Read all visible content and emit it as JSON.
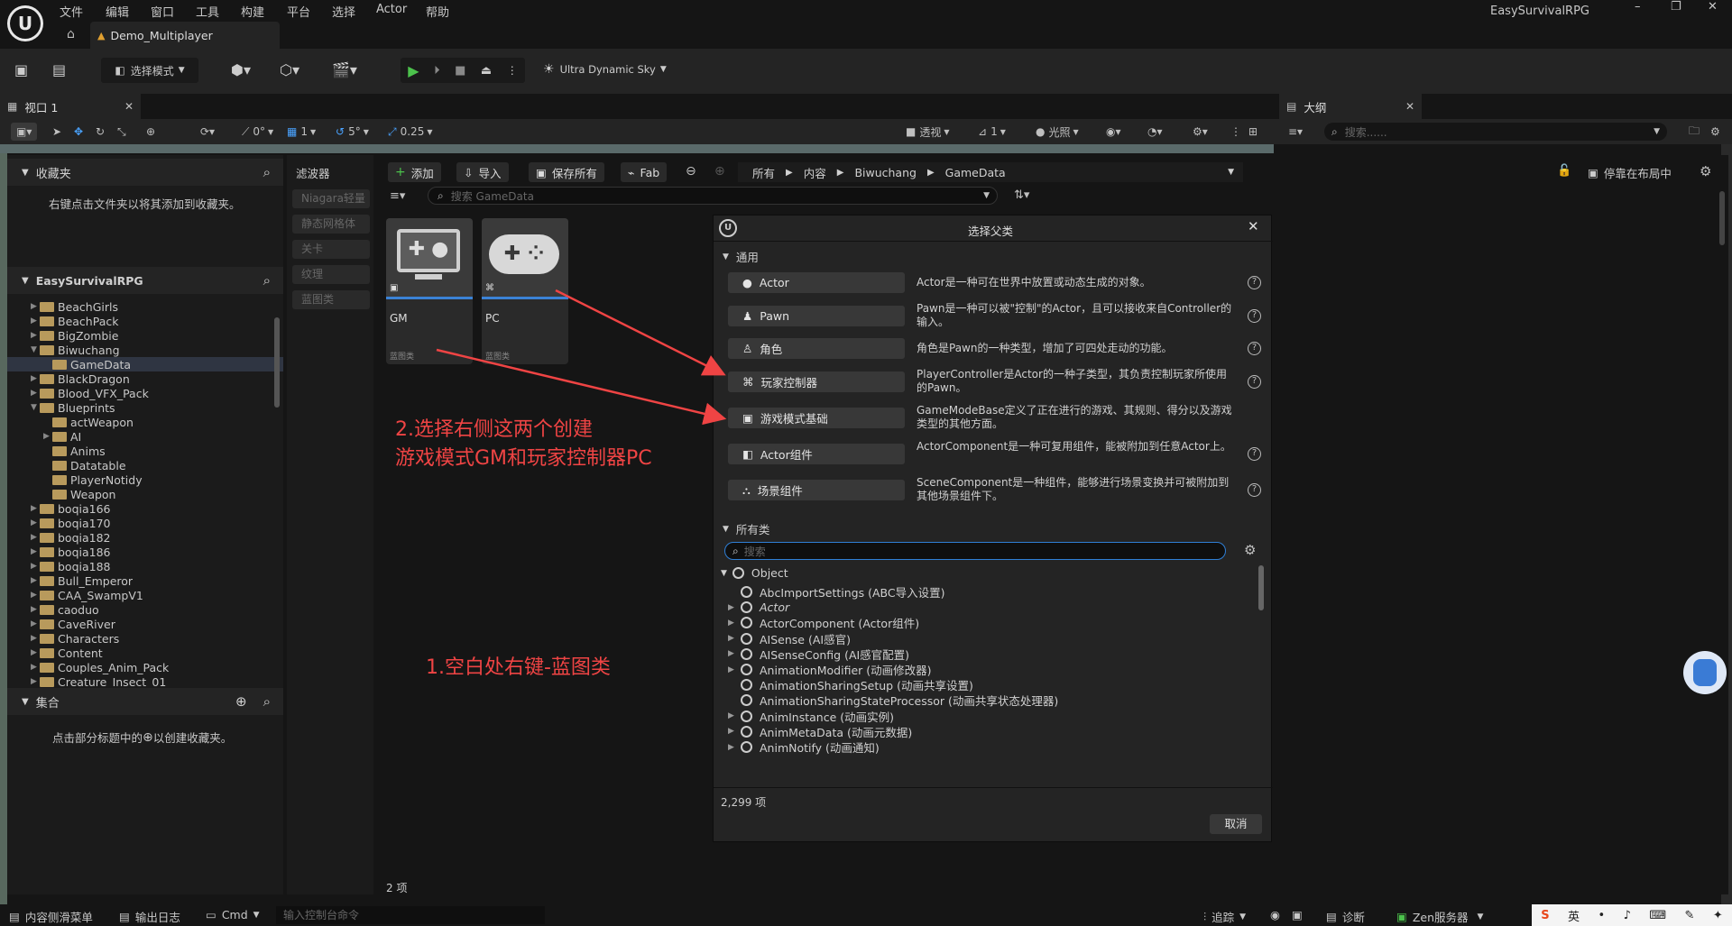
{
  "menu": {
    "items": [
      "文件",
      "编辑",
      "窗口",
      "工具",
      "构建",
      "平台",
      "选择",
      "Actor",
      "帮助"
    ],
    "project_name": "EasySurvivalRPG"
  },
  "tab": {
    "name": "Demo_Multiplayer"
  },
  "toolbar": {
    "mode_label": "选择模式",
    "sky_label": "Ultra Dynamic Sky"
  },
  "viewport": {
    "tab_label": "视口 1",
    "angle": "0°",
    "grid": "1",
    "rot": "5°",
    "scale": "0.25",
    "persp": "透视",
    "cam": "1",
    "lighting": "光照"
  },
  "outliner": {
    "title": "大纲",
    "search_placeholder": "搜索......"
  },
  "favorites": {
    "title": "收藏夹",
    "hint": "右键点击文件夹以将其添加到收藏夹。"
  },
  "project_tree": {
    "title": "EasySurvivalRPG",
    "items": [
      {
        "label": "BeachGirls",
        "level": 1,
        "arrow": "▶"
      },
      {
        "label": "BeachPack",
        "level": 1,
        "arrow": "▶"
      },
      {
        "label": "BigZombie",
        "level": 1,
        "arrow": "▶"
      },
      {
        "label": "Biwuchang",
        "level": 1,
        "arrow": "▼"
      },
      {
        "label": "GameData",
        "level": 2,
        "arrow": "",
        "selected": true
      },
      {
        "label": "BlackDragon",
        "level": 1,
        "arrow": "▶"
      },
      {
        "label": "Blood_VFX_Pack",
        "level": 1,
        "arrow": "▶"
      },
      {
        "label": "Blueprints",
        "level": 1,
        "arrow": "▼"
      },
      {
        "label": "actWeapon",
        "level": 2,
        "arrow": ""
      },
      {
        "label": "AI",
        "level": 2,
        "arrow": "▶"
      },
      {
        "label": "Anims",
        "level": 2,
        "arrow": ""
      },
      {
        "label": "Datatable",
        "level": 2,
        "arrow": ""
      },
      {
        "label": "PlayerNotidy",
        "level": 2,
        "arrow": ""
      },
      {
        "label": "Weapon",
        "level": 2,
        "arrow": ""
      },
      {
        "label": "boqia166",
        "level": 1,
        "arrow": "▶"
      },
      {
        "label": "boqia170",
        "level": 1,
        "arrow": "▶"
      },
      {
        "label": "boqia182",
        "level": 1,
        "arrow": "▶"
      },
      {
        "label": "boqia186",
        "level": 1,
        "arrow": "▶"
      },
      {
        "label": "boqia188",
        "level": 1,
        "arrow": "▶"
      },
      {
        "label": "Bull_Emperor",
        "level": 1,
        "arrow": "▶"
      },
      {
        "label": "CAA_SwampV1",
        "level": 1,
        "arrow": "▶"
      },
      {
        "label": "caoduo",
        "level": 1,
        "arrow": "▶"
      },
      {
        "label": "CaveRiver",
        "level": 1,
        "arrow": "▶"
      },
      {
        "label": "Characters",
        "level": 1,
        "arrow": "▶"
      },
      {
        "label": "Content",
        "level": 1,
        "arrow": "▶"
      },
      {
        "label": "Couples_Anim_Pack",
        "level": 1,
        "arrow": "▶"
      },
      {
        "label": "Creature_Insect_01",
        "level": 1,
        "arrow": "▶"
      }
    ]
  },
  "collections": {
    "title": "集合",
    "hint_pre": "点击部分标题中的",
    "hint_post": "以创建收藏夹。"
  },
  "filters": {
    "title": "滤波器",
    "chips": [
      "Niagara轻量",
      "静态网格体",
      "关卡",
      "纹理",
      "蓝图类"
    ]
  },
  "content_toolbar": {
    "add": "添加",
    "import": "导入",
    "save_all": "保存所有",
    "fab": "Fab",
    "search_placeholder": "搜索 GameData",
    "dock": "停靠在布局中"
  },
  "breadcrumb": [
    "所有",
    "内容",
    "Biwuchang",
    "GameData"
  ],
  "assets": [
    {
      "name": "GM",
      "type": "蓝图类"
    },
    {
      "name": "PC",
      "type": "蓝图类"
    }
  ],
  "item_count": "2 项",
  "dialog": {
    "title": "选择父类",
    "common_header": "通用",
    "common": [
      {
        "label": "Actor",
        "desc": "Actor是一种可在世界中放置或动态生成的对象。"
      },
      {
        "label": "Pawn",
        "desc": "Pawn是一种可以被\"控制\"的Actor，且可以接收来自Controller的输入。"
      },
      {
        "label": "角色",
        "desc": "角色是Pawn的一种类型，增加了可四处走动的功能。"
      },
      {
        "label": "玩家控制器",
        "desc": "PlayerController是Actor的一种子类型，其负责控制玩家所使用的Pawn。"
      },
      {
        "label": "游戏模式基础",
        "desc": "GameModeBase定义了正在进行的游戏、其规则、得分以及游戏类型的其他方面。"
      },
      {
        "label": "Actor组件",
        "desc": "ActorComponent是一种可复用组件，能被附加到任意Actor上。"
      },
      {
        "label": "场景组件",
        "desc": "SceneComponent是一种组件，能够进行场景变换并可被附加到其他场景组件下。"
      }
    ],
    "all_header": "所有类",
    "search_placeholder": "搜索",
    "root": "Object",
    "classes": [
      {
        "label": "AbcImportSettings (ABC导入设置)",
        "arrow": ""
      },
      {
        "label": "Actor",
        "arrow": "▶",
        "italic": true
      },
      {
        "label": "ActorComponent (Actor组件)",
        "arrow": "▶"
      },
      {
        "label": "AISense (AI感官)",
        "arrow": "▶"
      },
      {
        "label": "AISenseConfig (AI感官配置)",
        "arrow": "▶"
      },
      {
        "label": "AnimationModifier (动画修改器)",
        "arrow": "▶"
      },
      {
        "label": "AnimationSharingSetup (动画共享设置)",
        "arrow": ""
      },
      {
        "label": "AnimationSharingStateProcessor (动画共享状态处理器)",
        "arrow": ""
      },
      {
        "label": "AnimInstance (动画实例)",
        "arrow": "▶"
      },
      {
        "label": "AnimMetaData (动画元数据)",
        "arrow": "▶"
      },
      {
        "label": "AnimNotify (动画通知)",
        "arrow": "▶"
      }
    ],
    "count": "2,299 项",
    "cancel": "取消"
  },
  "annotations": {
    "a1": "1.空白处右键-蓝图类",
    "a2_line1": "2.选择右侧这两个创建",
    "a2_line2": "游戏模式GM和玩家控制器PC"
  },
  "status": {
    "drawer": "内容侧滑菜单",
    "log": "输出日志",
    "cmd": "Cmd",
    "console_placeholder": "输入控制台命令",
    "trace": "追踪",
    "diag": "诊断",
    "zen": "Zen服务器"
  },
  "ime": {
    "lang": "英"
  }
}
